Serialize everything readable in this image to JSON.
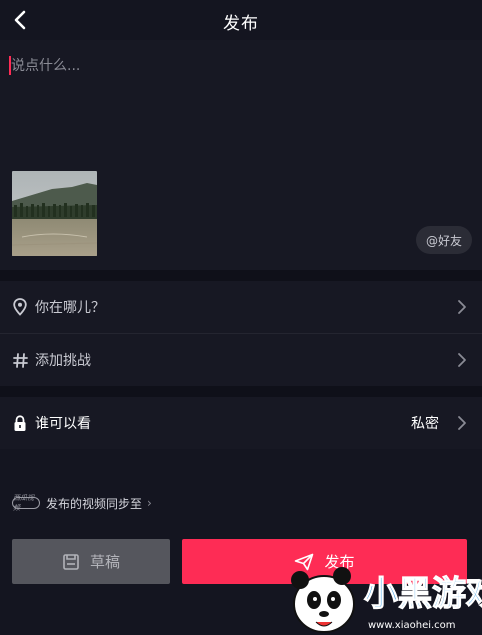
{
  "header": {
    "title": "发布",
    "back_icon": "chevron-left-icon"
  },
  "compose": {
    "caption_value": "",
    "caption_placeholder": "说点什么...",
    "mention_label": "@好友"
  },
  "options": {
    "location_label": "你在哪儿？",
    "challenge_label": "添加挑战",
    "privacy_label": "谁可以看",
    "privacy_value": "私密"
  },
  "sync": {
    "text": "发布的视频同步至",
    "logo_text": "西瓜视频"
  },
  "actions": {
    "draft_label": "草稿",
    "publish_label": "发布"
  },
  "watermark": {
    "brand": "小黑游戏",
    "url": "www.xiaohei.com"
  },
  "colors": {
    "accent": "#fe2c55",
    "background": "#141520",
    "panel": "#171823",
    "draft_bg": "#55565d"
  }
}
